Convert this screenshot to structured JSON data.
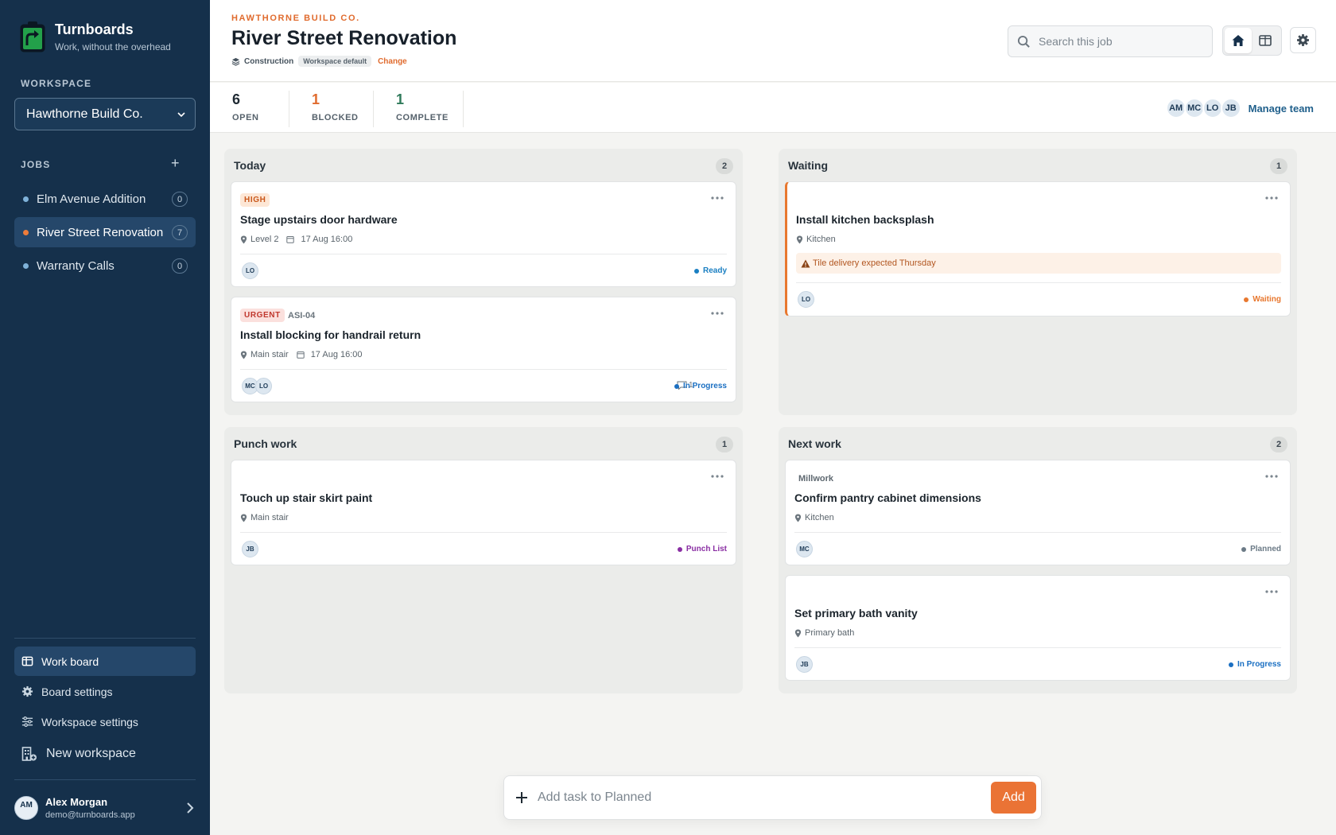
{
  "brand": {
    "name": "Turnboards",
    "tagline": "Work, without the overhead"
  },
  "sidebar": {
    "workspace_label": "WORKSPACE",
    "workspace_value": "Hawthorne Build Co.",
    "jobs_label": "JOBS",
    "jobs_add": "+",
    "jobs": [
      {
        "name": "Elm Avenue Addition",
        "count": "0"
      },
      {
        "name": "River Street Renovation",
        "count": "7"
      },
      {
        "name": "Warranty Calls",
        "count": "0"
      }
    ],
    "nav": [
      {
        "label": "Work board",
        "icon": "board-icon"
      },
      {
        "label": "Board settings",
        "icon": "gear-icon"
      },
      {
        "label": "Workspace settings",
        "icon": "sliders-icon"
      },
      {
        "label": "New workspace",
        "icon": "building-add-icon"
      }
    ],
    "user": {
      "initials": "AM",
      "name": "Alex Morgan",
      "email": "demo@turnboards.app"
    }
  },
  "header": {
    "company": "HAWTHORNE BUILD CO.",
    "title": "River Street Renovation",
    "type": "Construction",
    "badge": "Workspace default",
    "change": "Change",
    "search_placeholder": "Search this job"
  },
  "stats": [
    {
      "value": "6",
      "label": "OPEN",
      "color": "#1f2a33"
    },
    {
      "value": "1",
      "label": "BLOCKED",
      "color": "#e06b2e"
    },
    {
      "value": "1",
      "label": "COMPLETE",
      "color": "#2f7a5a"
    }
  ],
  "team": {
    "members": [
      "AM",
      "MC",
      "LO",
      "JB"
    ],
    "manage": "Manage team"
  },
  "columns": [
    {
      "title": "Today",
      "count": "2",
      "cards": [
        {
          "tag": "HIGH",
          "title": "Stage upstairs door hardware",
          "location": "Level 2",
          "due": "17 Aug 16:00",
          "assignees": [
            "LO"
          ],
          "status": "Ready",
          "status_color": "#1a7fc2"
        },
        {
          "tag": "URGENT",
          "ref": "ASI-04",
          "title": "Install blocking for handrail return",
          "location": "Main stair",
          "due": "17 Aug 16:00",
          "assignees": [
            "MC",
            "LO"
          ],
          "comments": "1",
          "status": "In Progress",
          "status_color": "#1a6fc2"
        }
      ]
    },
    {
      "title": "Waiting",
      "count": "1",
      "cards": [
        {
          "title": "Install kitchen backsplash",
          "location": "Kitchen",
          "alert": "Tile delivery expected Thursday",
          "assignees": [
            "LO"
          ],
          "status": "Waiting",
          "status_color": "#e8782f"
        }
      ]
    },
    {
      "title": "Punch work",
      "count": "1",
      "cards": [
        {
          "title": "Touch up stair skirt paint",
          "location": "Main stair",
          "assignees": [
            "JB"
          ],
          "status": "Punch List",
          "status_color": "#8a2ea3"
        }
      ]
    },
    {
      "title": "Next work",
      "count": "2",
      "cards": [
        {
          "category": "Millwork",
          "title": "Confirm pantry cabinet dimensions",
          "location": "Kitchen",
          "assignees": [
            "MC"
          ],
          "status": "Planned",
          "status_color": "#6b7a86"
        },
        {
          "title": "Set primary bath vanity",
          "location": "Primary bath",
          "assignees": [
            "JB"
          ],
          "status": "In Progress",
          "status_color": "#1a6fc2"
        }
      ]
    }
  ],
  "add_task": {
    "placeholder": "Add task to Planned",
    "button": "Add"
  }
}
